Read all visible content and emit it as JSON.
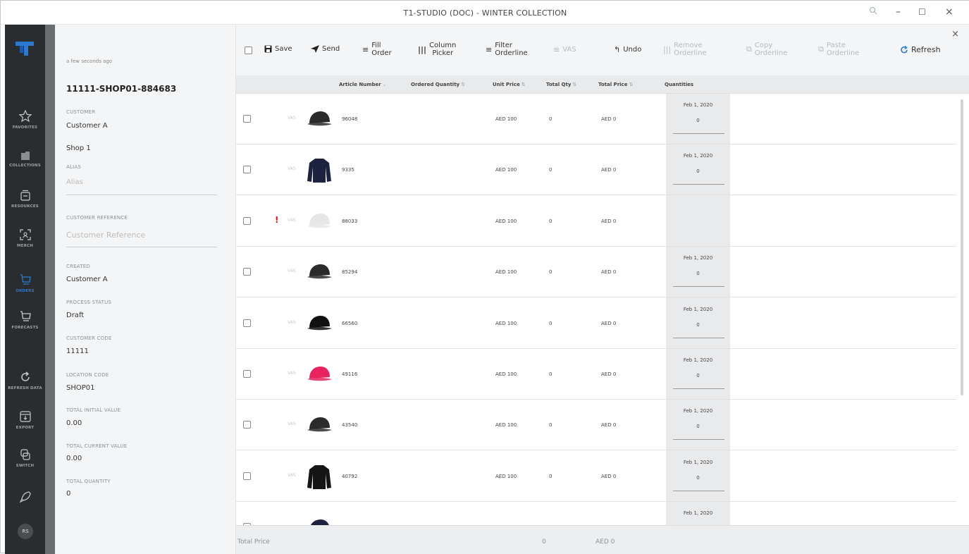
{
  "window": {
    "title": "T1-STUDIO (DOC) - WINTER COLLECTION",
    "zoom_icon": "zoom-icon",
    "minimize": "–",
    "maximize": "☐",
    "close": "×"
  },
  "nav": {
    "items": [
      {
        "label": "FAVORITES",
        "icon": "star-icon"
      },
      {
        "label": "COLLECTIONS",
        "icon": "folder-icon"
      },
      {
        "label": "RESOURCES",
        "icon": "resources-icon"
      },
      {
        "label": "MERCH",
        "icon": "merch-icon"
      },
      {
        "label": "ORDERS",
        "icon": "cart-icon"
      },
      {
        "label": "FORECASTS",
        "icon": "forecast-cart-icon"
      },
      {
        "label": "REFRESH DATA",
        "icon": "refresh-icon"
      },
      {
        "label": "EXPORT",
        "icon": "export-icon"
      },
      {
        "label": "SWITCH",
        "icon": "switch-icon"
      }
    ],
    "avatar": "RS",
    "active_color": "#2a7ad2"
  },
  "side": {
    "saved": "a few seconds ago",
    "order_code": "11111-SHOP01-884683",
    "customer_label": "CUSTOMER",
    "customer": "Customer A",
    "shop": "Shop 1",
    "alias_label": "ALIAS",
    "alias_placeholder": "Alias",
    "custref_label": "CUSTOMER REFERENCE",
    "custref_placeholder": "Customer Reference",
    "created_label": "CREATED",
    "created": "Customer A",
    "status_label": "PROCESS STATUS",
    "status": "Draft",
    "ccode_label": "CUSTOMER CODE",
    "ccode": "11111",
    "loc_label": "LOCATION CODE",
    "loc": "SHOP01",
    "tiv_label": "TOTAL INITIAL VALUE",
    "tiv": "0.00",
    "tcv_label": "TOTAL CURRENT VALUE",
    "tcv": "0.00",
    "tq_label": "TOTAL QUANTITY",
    "tq": "0"
  },
  "toolbar": {
    "save": "Save",
    "send": "Send",
    "fill_1": "Fill",
    "fill_2": "Order",
    "column_1": "Column",
    "column_2": "Picker",
    "filter_1": "Filter",
    "filter_2": "Orderline",
    "vas": "VAS",
    "undo": "Undo",
    "remove_1": "Remove",
    "remove_2": "Orderline",
    "copy_1": "Copy",
    "copy_2": "Orderline",
    "paste_1": "Paste",
    "paste_2": "Orderline",
    "refresh": "Refresh",
    "close": "×"
  },
  "table": {
    "headers": {
      "article": "Article Number",
      "ordered": "Ordered Quantity",
      "unit": "Unit Price",
      "totalqty": "Total Qty",
      "totalprice": "Total Price",
      "quantities": "Quantities"
    },
    "rows": [
      {
        "vas": "VAS",
        "warn": "",
        "article": "96048",
        "unit": "AED 100",
        "tq": "0",
        "tp": "AED 0",
        "date": "Feb 1, 2020",
        "qty": "0",
        "img": "cap",
        "color": "#2b2b2b"
      },
      {
        "vas": "VAS",
        "warn": "",
        "article": "9335",
        "unit": "AED 100",
        "tq": "0",
        "tp": "AED 0",
        "date": "Feb 1, 2020",
        "qty": "0",
        "img": "sweater",
        "color": "#1c2240"
      },
      {
        "vas": "VAS",
        "warn": "!",
        "article": "88033",
        "unit": "AED 100",
        "tq": "0",
        "tp": "AED 0",
        "date": "",
        "qty": "",
        "img": "cap",
        "color": "#e6e6e6"
      },
      {
        "vas": "VAS",
        "warn": "",
        "article": "85294",
        "unit": "AED 100",
        "tq": "0",
        "tp": "AED 0",
        "date": "Feb 1, 2020",
        "qty": "0",
        "img": "cap",
        "color": "#2b2b2b"
      },
      {
        "vas": "VAS",
        "warn": "",
        "article": "66560",
        "unit": "AED 100",
        "tq": "0",
        "tp": "AED 0",
        "date": "Feb 1, 2020",
        "qty": "0",
        "img": "cap",
        "color": "#111111"
      },
      {
        "vas": "VAS",
        "warn": "",
        "article": "49116",
        "unit": "AED 100",
        "tq": "0",
        "tp": "AED 0",
        "date": "Feb 1, 2020",
        "qty": "0",
        "img": "cap",
        "color": "#e8235f"
      },
      {
        "vas": "VAS",
        "warn": "",
        "article": "43540",
        "unit": "AED 100",
        "tq": "0",
        "tp": "AED 0",
        "date": "Feb 1, 2020",
        "qty": "0",
        "img": "cap",
        "color": "#2b2b2b"
      },
      {
        "vas": "VAS",
        "warn": "",
        "article": "40792",
        "unit": "AED 100",
        "tq": "0",
        "tp": "AED 0",
        "date": "Feb 1, 2020",
        "qty": "0",
        "img": "sweater",
        "color": "#151515"
      },
      {
        "vas": "",
        "warn": "",
        "article": "",
        "unit": "",
        "tq": "",
        "tp": "",
        "date": "Feb 1, 2020",
        "qty": "",
        "img": "cap",
        "color": "#1c2240"
      }
    ]
  },
  "footer": {
    "label": "Total Price",
    "qty": "0",
    "price": "AED 0"
  }
}
